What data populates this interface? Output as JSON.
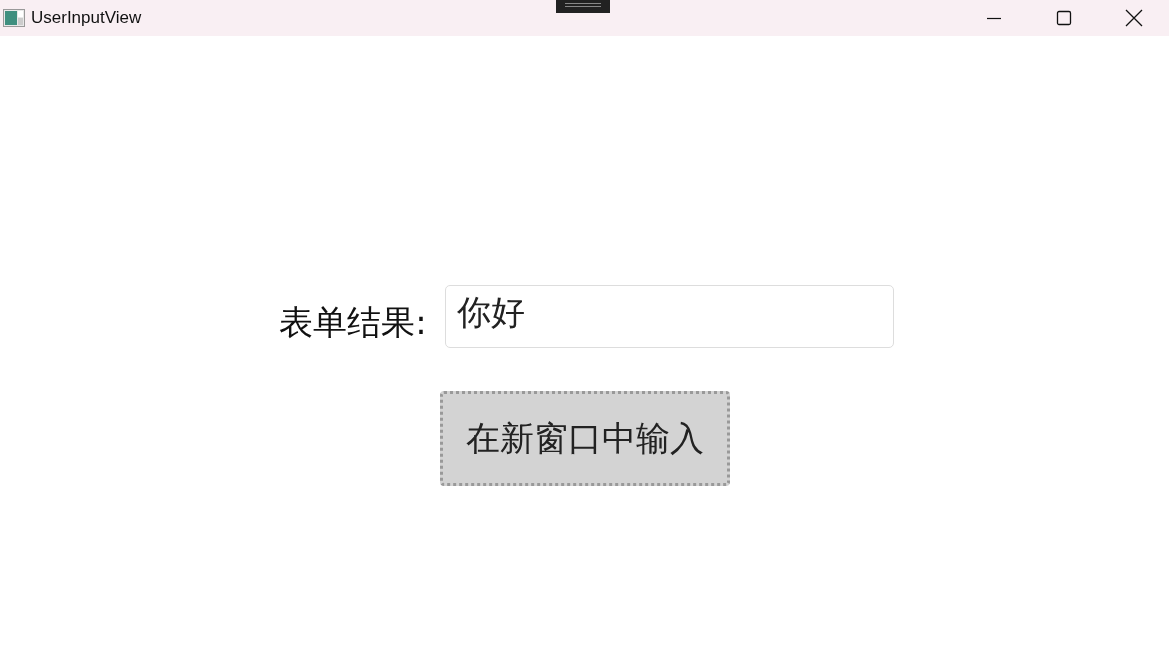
{
  "window": {
    "title": "UserInputView"
  },
  "form": {
    "label": "表单结果:",
    "value": "你好"
  },
  "button": {
    "label": "在新窗口中输入",
    "focused": true
  }
}
